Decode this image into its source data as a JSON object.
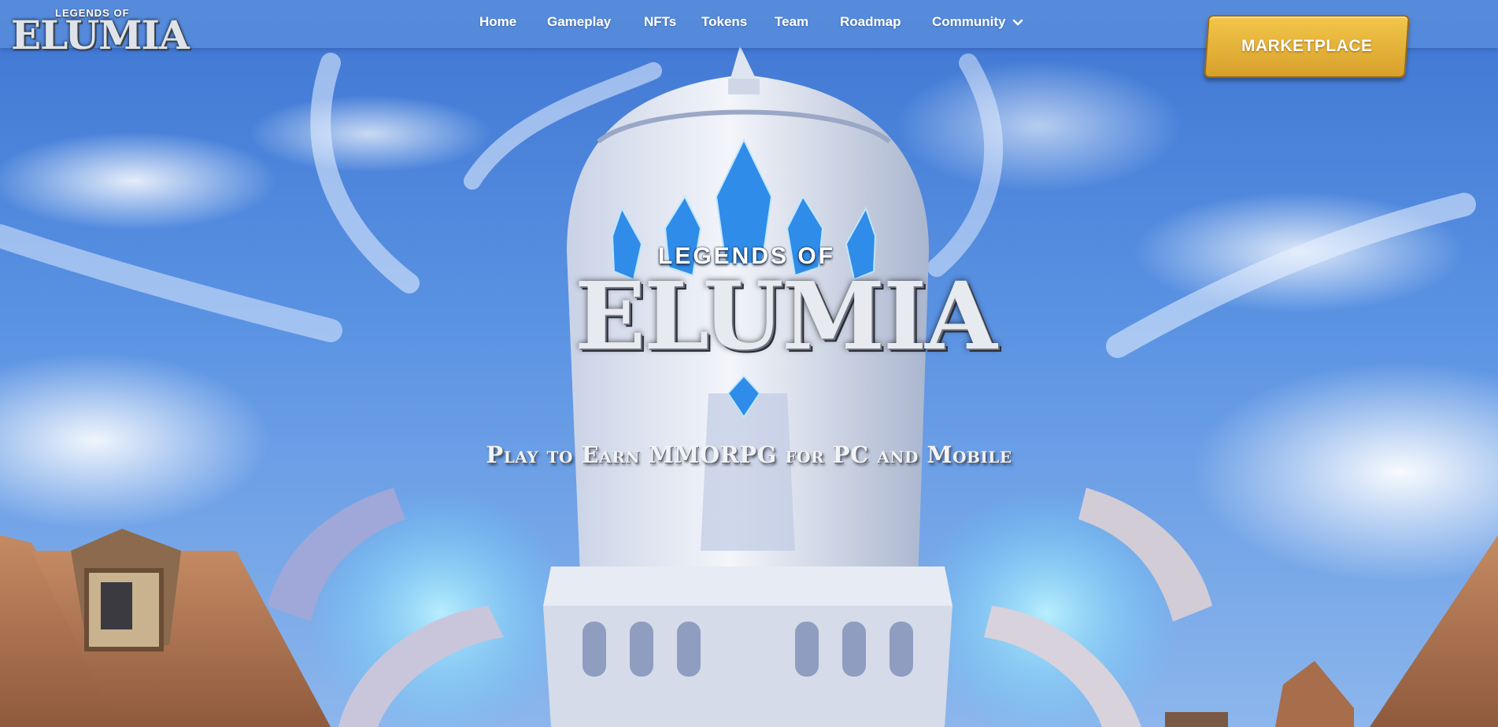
{
  "brand": {
    "logo_top": "LEGENDS OF",
    "logo_main": "ELUMIA"
  },
  "nav": {
    "items": [
      {
        "label": "Home"
      },
      {
        "label": "Gameplay"
      },
      {
        "label": "NFTs"
      },
      {
        "label": "Tokens"
      },
      {
        "label": "Team"
      },
      {
        "label": "Roadmap"
      },
      {
        "label": "Community"
      }
    ],
    "community_icon": "chevron-down-icon",
    "marketplace_label": "MARKETPLACE"
  },
  "hero": {
    "logo_top": "LEGENDS OF",
    "logo_main": "ELUMIA",
    "tagline": "Play to Earn MMORPG for PC and Mobile"
  },
  "colors": {
    "nav_bg": "#5d8fda",
    "accent_gold": "#e2b23a",
    "sky": "#4f86d8"
  }
}
